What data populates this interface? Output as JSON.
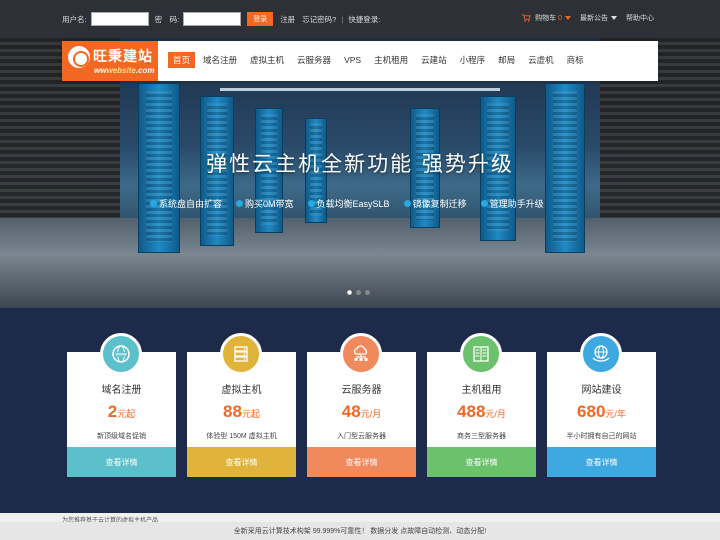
{
  "topbar": {
    "username_label": "用户名:",
    "password_label": "密　码:",
    "login_button": "登录",
    "register_link": "注册",
    "forgot_link": "忘记密码?",
    "separator": "|",
    "quick_login": "快捷登录:",
    "cart_label": "购物车",
    "cart_count": "0",
    "notice_label": "最新公告",
    "help_label": "帮助中心"
  },
  "logo": {
    "cn": "旺秉建站",
    "en_prefix": "ww",
    "en_main": "website",
    "en_suffix": ".com"
  },
  "nav": {
    "items": [
      {
        "label": "首页",
        "active": true
      },
      {
        "label": "域名注册"
      },
      {
        "label": "虚拟主机"
      },
      {
        "label": "云服务器"
      },
      {
        "label": "VPS"
      },
      {
        "label": "主机租用"
      },
      {
        "label": "云建站"
      },
      {
        "label": "小程序"
      },
      {
        "label": "邮局"
      },
      {
        "label": "云虚机"
      },
      {
        "label": "商标"
      }
    ]
  },
  "hero": {
    "title": "弹性云主机全新功能  强势升级",
    "features": [
      "系统盘自由扩容",
      "购买0M带宽",
      "负载均衡EasySLB",
      "镜像复制迁移",
      "管理助手升级"
    ]
  },
  "cards": [
    {
      "title": "域名注册",
      "price": "2",
      "unit": "元起",
      "desc": "新顶级域名促销",
      "button": "查看详情",
      "color": "#5bc0c9",
      "icon": "globe-www-icon"
    },
    {
      "title": "虚拟主机",
      "price": "88",
      "unit": "元起",
      "desc": "体验型 150M 虚拟主机",
      "button": "查看详情",
      "color": "#e0b43a",
      "icon": "server-stack-icon"
    },
    {
      "title": "云服务器",
      "price": "48",
      "unit": "元/月",
      "desc": "入门型云服务器",
      "button": "查看详情",
      "color": "#f08a5d",
      "icon": "cloud-network-icon"
    },
    {
      "title": "主机租用",
      "price": "488",
      "unit": "元/月",
      "desc": "商务三型服务器",
      "button": "查看详情",
      "color": "#6cc16c",
      "icon": "rack-server-icon"
    },
    {
      "title": "网站建设",
      "price": "680",
      "unit": "元/年",
      "desc": "半小时拥有自己的网站",
      "button": "查看详情",
      "color": "#3ea8e0",
      "icon": "globe-hands-icon"
    }
  ],
  "footer": {
    "left_note": "为您推荐基于云计算的虚拟主机产品",
    "center_note": "全新采用云计算技术构架 99.999%可靠性！ 数据分发 点故障自动检测、动态分配!"
  }
}
